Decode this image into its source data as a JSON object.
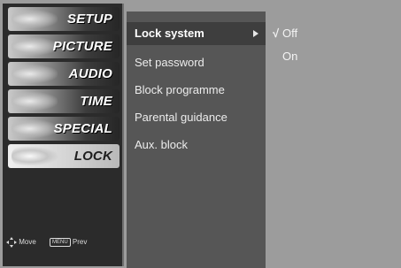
{
  "sidebar": {
    "tabs": [
      {
        "label": "SETUP",
        "selected": false
      },
      {
        "label": "PICTURE",
        "selected": false
      },
      {
        "label": "AUDIO",
        "selected": false
      },
      {
        "label": "TIME",
        "selected": false
      },
      {
        "label": "SPECIAL",
        "selected": false
      },
      {
        "label": "LOCK",
        "selected": true
      }
    ],
    "hints": {
      "move_label": "Move",
      "prev_key": "MENU",
      "prev_label": "Prev"
    }
  },
  "menu": {
    "items": [
      {
        "label": "Lock system",
        "active": true,
        "has_submenu": true
      },
      {
        "label": "Set password",
        "active": false
      },
      {
        "label": "Block programme",
        "active": false
      },
      {
        "label": "Parental guidance",
        "active": false
      },
      {
        "label": "Aux. block",
        "active": false
      }
    ]
  },
  "options": {
    "items": [
      {
        "label": "Off",
        "checked": true
      },
      {
        "label": "On",
        "checked": false
      }
    ],
    "check_glyph": "√"
  },
  "colors": {
    "sidebar_bg": "#2b2b2b",
    "menu_bg": "#565656",
    "menu_active_bg": "#3e3e3e",
    "options_bg": "#9c9c9c"
  }
}
